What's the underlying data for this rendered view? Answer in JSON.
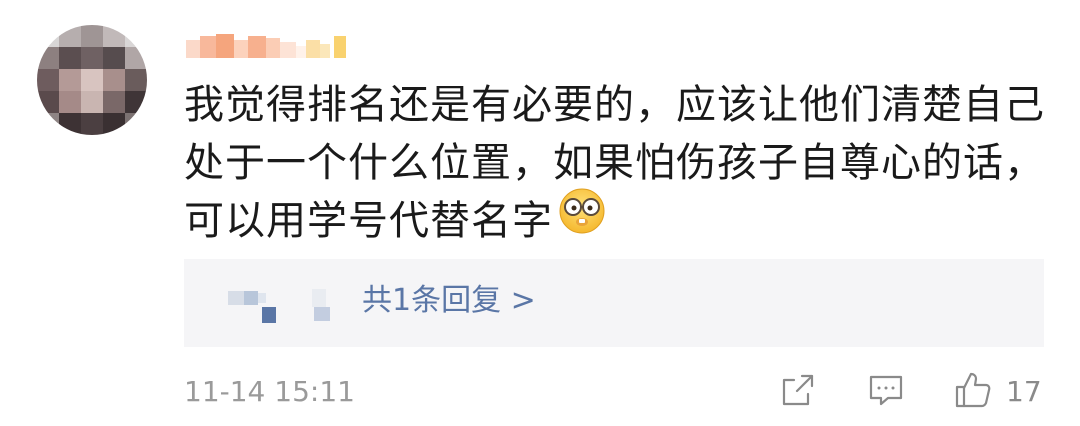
{
  "comment": {
    "text": "我觉得排名还是有必要的，应该让他们清楚自己处于一个什么位置，如果怕伤孩子自尊心的话，可以用学号代替名字",
    "emoji": "nerd-face-emoji"
  },
  "replies": {
    "summary": "共1条回复 >"
  },
  "footer": {
    "timestamp": "11-14 15:11",
    "like_count": "17"
  },
  "icons": {
    "share": "share-icon",
    "comment": "comment-icon",
    "like": "thumbs-up-icon"
  },
  "colors": {
    "text": "#1a1a1a",
    "link": "#5a76a6",
    "muted": "#9a9a9a",
    "reply_bg": "#f5f5f7"
  }
}
